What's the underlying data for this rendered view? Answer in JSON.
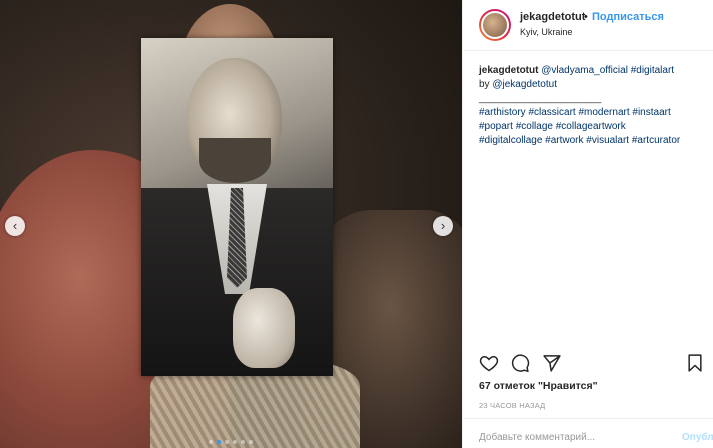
{
  "post": {
    "username": "jekagdetotut",
    "separator": "•",
    "follow_label": "Подписаться",
    "location": "Kyiv, Ukraine"
  },
  "caption": {
    "author": "jekagdetotut",
    "line1_mention": "@vladyama_official",
    "line1_tag": "#digitalart",
    "line2_prefix": "by",
    "line2_mention": "@jekagdetotut",
    "divider": "______________________",
    "tags_line1": "#arthistory #classicart #modernart #instaart",
    "tags_line2": "#popart #collage #collageartwork",
    "tags_line3": "#digitalcollage #artwork #visualart #artcurator"
  },
  "carousel": {
    "prev_icon": "‹",
    "next_icon": "›",
    "slide_count": 6,
    "active_slide": 1
  },
  "icons": [
    "heart-icon",
    "comment-icon",
    "share-icon",
    "bookmark-icon"
  ],
  "stats": {
    "likes": "67 отметок \"Нравится\"",
    "time": "23 ЧАСОВ НАЗАД"
  },
  "comment": {
    "placeholder": "Добавьте комментарий...",
    "publish_label": "Опубл."
  },
  "colors": {
    "link": "#003569",
    "follow": "#3897f0",
    "publish_disabled": "#b2dffc"
  }
}
